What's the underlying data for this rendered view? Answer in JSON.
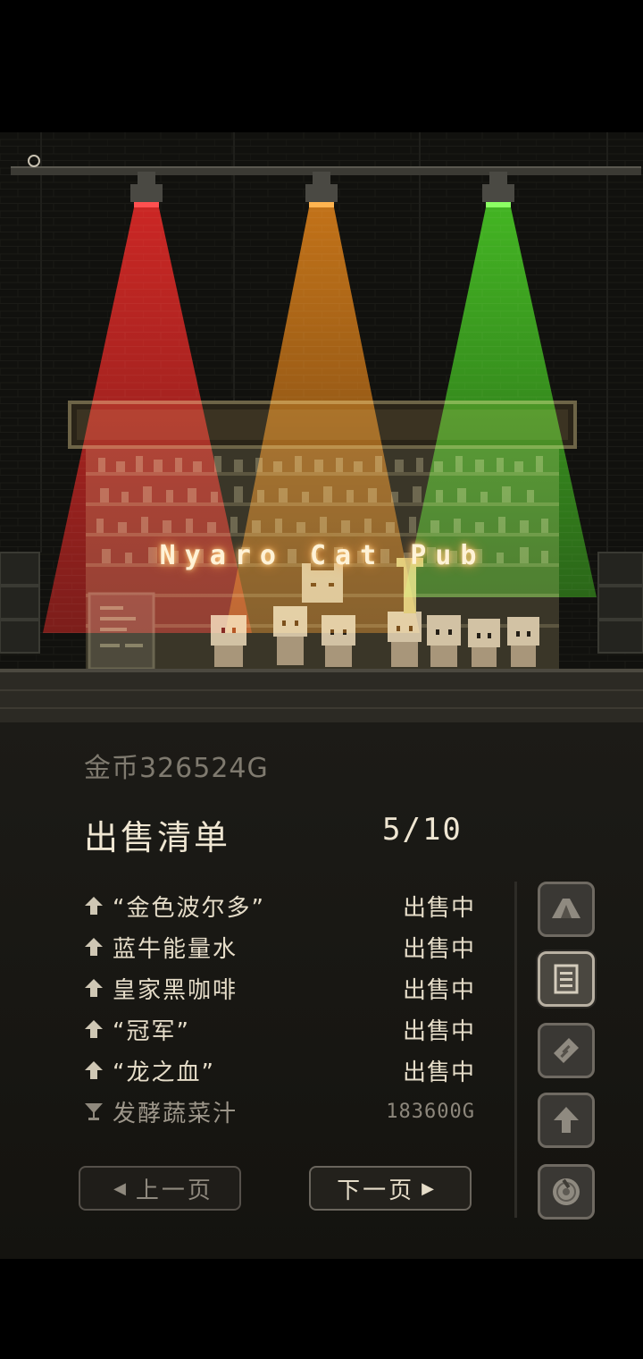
{
  "scene": {
    "sign_text": "Nyaro Cat Pub",
    "light_colors": [
      "#e01818",
      "#e88412",
      "#3cc818"
    ]
  },
  "gold_label": "金币326524G",
  "list_title": "出售清单",
  "page_indicator": "5/10",
  "items": [
    {
      "icon": "arrow-up-icon",
      "name": "“金色波尔多”",
      "status": "出售中",
      "dim": false
    },
    {
      "icon": "arrow-up-icon",
      "name": "蓝牛能量水",
      "status": "出售中",
      "dim": false
    },
    {
      "icon": "arrow-up-icon",
      "name": "皇家黑咖啡",
      "status": "出售中",
      "dim": false
    },
    {
      "icon": "arrow-up-icon",
      "name": "“冠军”",
      "status": "出售中",
      "dim": false
    },
    {
      "icon": "arrow-up-icon",
      "name": "“龙之血”",
      "status": "出售中",
      "dim": false
    },
    {
      "icon": "cocktail-glass-icon",
      "name": "发酵蔬菜汁",
      "status": "183600G",
      "dim": true
    }
  ],
  "buttons": {
    "prev": "上一页",
    "next": "下一页"
  },
  "side_tabs": [
    {
      "icon": "tent-icon",
      "active": false
    },
    {
      "icon": "document-list-icon",
      "active": true
    },
    {
      "icon": "scroll-icon",
      "active": false
    },
    {
      "icon": "upgrade-arrow-icon",
      "active": false
    },
    {
      "icon": "record-disc-icon",
      "active": false
    }
  ]
}
